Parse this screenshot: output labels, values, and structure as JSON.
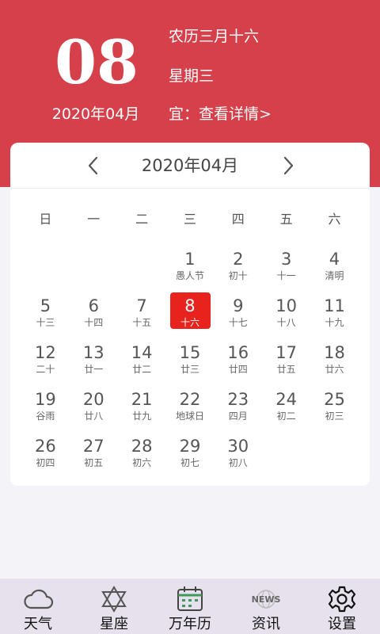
{
  "header": {
    "day": "08",
    "year_month": "2020年04月",
    "lunar_date": "农历三月十六",
    "weekday": "星期三",
    "yi_link": "宜：查看详情>"
  },
  "calendar": {
    "month_title": "2020年04月",
    "weekdays": [
      "日",
      "一",
      "二",
      "三",
      "四",
      "五",
      "六"
    ],
    "leading_empty": 3,
    "selected_day": 8,
    "days": [
      {
        "d": "1",
        "l": "愚人节"
      },
      {
        "d": "2",
        "l": "初十"
      },
      {
        "d": "3",
        "l": "十一"
      },
      {
        "d": "4",
        "l": "清明"
      },
      {
        "d": "5",
        "l": "十三"
      },
      {
        "d": "6",
        "l": "十四"
      },
      {
        "d": "7",
        "l": "十五"
      },
      {
        "d": "8",
        "l": "十六"
      },
      {
        "d": "9",
        "l": "十七"
      },
      {
        "d": "10",
        "l": "十八"
      },
      {
        "d": "11",
        "l": "十九"
      },
      {
        "d": "12",
        "l": "二十"
      },
      {
        "d": "13",
        "l": "廿一"
      },
      {
        "d": "14",
        "l": "廿二"
      },
      {
        "d": "15",
        "l": "廿三"
      },
      {
        "d": "16",
        "l": "廿四"
      },
      {
        "d": "17",
        "l": "廿五"
      },
      {
        "d": "18",
        "l": "廿六"
      },
      {
        "d": "19",
        "l": "谷雨"
      },
      {
        "d": "20",
        "l": "廿八"
      },
      {
        "d": "21",
        "l": "廿九"
      },
      {
        "d": "22",
        "l": "地球日"
      },
      {
        "d": "23",
        "l": "四月"
      },
      {
        "d": "24",
        "l": "初二"
      },
      {
        "d": "25",
        "l": "初三"
      },
      {
        "d": "26",
        "l": "初四"
      },
      {
        "d": "27",
        "l": "初五"
      },
      {
        "d": "28",
        "l": "初六"
      },
      {
        "d": "29",
        "l": "初七"
      },
      {
        "d": "30",
        "l": "初八"
      }
    ]
  },
  "tabs": [
    {
      "label": "天气",
      "icon": "cloud-icon"
    },
    {
      "label": "星座",
      "icon": "star-of-david-icon"
    },
    {
      "label": "万年历",
      "icon": "calendar-icon"
    },
    {
      "label": "资讯",
      "icon": "news-globe-icon",
      "icon_text": "NEWS"
    },
    {
      "label": "设置",
      "icon": "gear-icon"
    }
  ],
  "colors": {
    "header_bg": "#d5404b",
    "selected_bg": "#e8221d",
    "tabbar_bg": "#e7e1ed",
    "calendar_icon_accent": "#3d9a5b"
  }
}
